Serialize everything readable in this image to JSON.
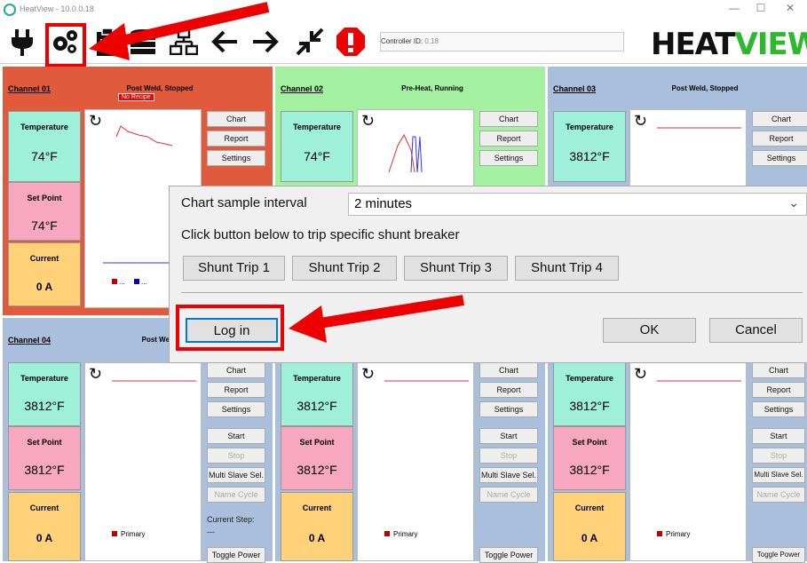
{
  "window": {
    "title": "HeatView - 10.0.0.18",
    "min": "—",
    "max": "☐",
    "close": "✕"
  },
  "toolbar": {
    "icons": [
      "plug-icon",
      "gears-icon",
      "clipboard-icon",
      "database-icon",
      "network-icon",
      "arrow-left-icon",
      "arrow-right-icon",
      "collapse-icon",
      "alert-icon"
    ],
    "controller_label": "Controller ID:",
    "controller_value": "0.18",
    "logo_a": "HEAT",
    "logo_b": "VIEW"
  },
  "colors": {
    "ch1": "#e15a3b",
    "ch2": "#a3f0a0",
    "ch3": "#a9bfdc",
    "temp": "#9ef0d8",
    "setpoint": "#f7a8c0",
    "current": "#ffd27a",
    "accent_red": "#e00000"
  },
  "channels": [
    {
      "name": "Channel 01",
      "status": "Post Weld, Stopped",
      "badge": "No Recipe",
      "temp": "74°F",
      "setpoint": "74°F",
      "current": "0 A"
    },
    {
      "name": "Channel 02",
      "status": "Pre-Heat, Running",
      "temp": "74°F"
    },
    {
      "name": "Channel 03",
      "status": "Post Weld, Stopped",
      "temp": "3812°F"
    },
    {
      "name": "Channel 04",
      "status": "Post Weld,",
      "temp": "3812°F",
      "setpoint": "3812°F",
      "current": "0 A"
    },
    {
      "temp": "3812°F",
      "setpoint": "3812°F",
      "current": "0 A"
    },
    {
      "temp": "3812°F",
      "setpoint": "3812°F",
      "current": "0 A"
    }
  ],
  "tile_labels": {
    "temperature": "Temperature",
    "setpoint": "Set Point",
    "current": "Current"
  },
  "panel_buttons": {
    "chart": "Chart",
    "report": "Report",
    "settings": "Settings",
    "start": "Start",
    "stop": "Stop",
    "multi": "Multi Slave Sel.",
    "name": "Name Cycle",
    "current_step": "Current Step:",
    "step_val": "---",
    "toggle": "Toggle Power",
    "primary": "Primary",
    "legend_dots": "... ..."
  },
  "dialog": {
    "interval_label": "Chart sample interval",
    "interval_value": "2 minutes",
    "shunt_label": "Click button below to trip specific shunt breaker",
    "shunts": [
      "Shunt Trip 1",
      "Shunt Trip 2",
      "Shunt Trip 3",
      "Shunt Trip 4"
    ],
    "login": "Log in",
    "ok": "OK",
    "cancel": "Cancel"
  }
}
